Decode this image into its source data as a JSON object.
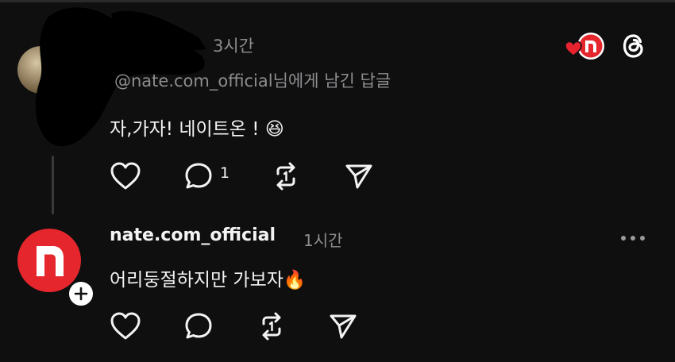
{
  "colors": {
    "background": "#0f0f10",
    "text": "#f3f3f3",
    "muted": "#8d8d8f",
    "brand": "#e5262d"
  },
  "header": {
    "brand_logo_icon": "nate-heart-logo-icon",
    "threads_icon": "threads-logo-icon"
  },
  "post1": {
    "username": "",
    "time": "3시간",
    "reply_to_handle": "@nate.com_official",
    "reply_to_suffix": "님에게 남긴 답글",
    "text": "자,가자! 네이트온 ! ",
    "emoji": "😆",
    "actions": {
      "like_icon": "heart-icon",
      "comment_icon": "comment-icon",
      "comment_count": "1",
      "repost_icon": "repost-icon",
      "share_icon": "send-icon"
    }
  },
  "post2": {
    "username": "nate.com_official",
    "time": "1시간",
    "text": "어리둥절하지만 가보자",
    "emoji": "🔥",
    "avatar_letter": "n",
    "follow_icon": "plus-icon",
    "more_icon": "more-icon",
    "actions": {
      "like_icon": "heart-icon",
      "comment_icon": "comment-icon",
      "repost_icon": "repost-icon",
      "share_icon": "send-icon"
    }
  }
}
